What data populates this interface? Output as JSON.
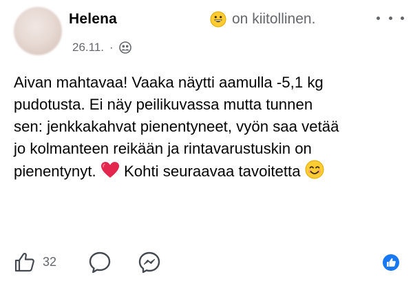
{
  "post": {
    "author": "Helena",
    "feeling_text": "on kiitollinen.",
    "date": "26.11.",
    "date_separator": "·",
    "privacy_icon": "friends-icon",
    "more_icon": "more-options-icon",
    "text_lines": [
      "Aivan mahtavaa! Vaaka näytti aamulla -5,1 kg",
      "pudotusta. Ei näy peilikuvassa mutta tunnen",
      "sen: jenkkakahvat pienentyneet, vyön saa vetää",
      "jo kolmanteen reikään ja rintavarustuskin on",
      "pienentynyt."
    ],
    "text_tail": "Kohti seuraavaa tavoitetta"
  },
  "actions": {
    "like_count": "32",
    "like_icon": "thumbs-up-icon",
    "comment_icon": "comment-icon",
    "share_icon": "messenger-icon",
    "reaction_icon": "like-reaction-icon"
  },
  "colors": {
    "text": "#050505",
    "secondary": "#65676b",
    "brand_blue": "#1877f2",
    "heart": "#e2264d",
    "emoji_yellow": "#ffcc33"
  }
}
